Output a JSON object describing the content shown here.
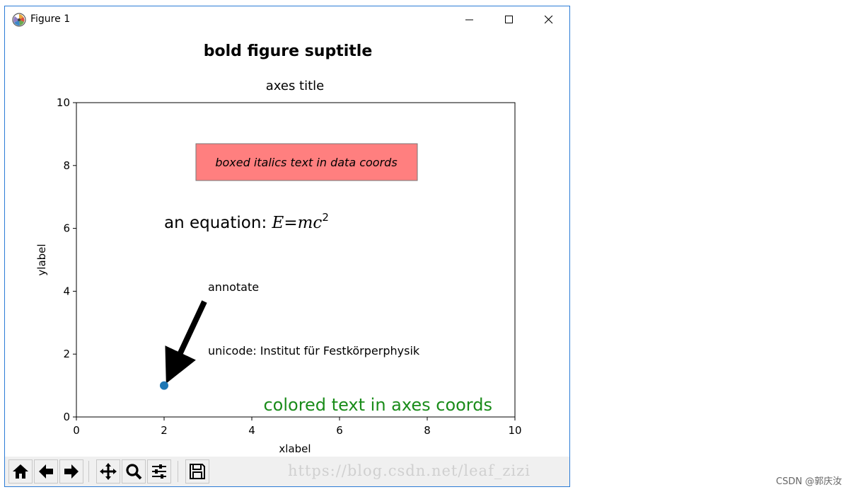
{
  "window": {
    "title": "Figure 1"
  },
  "figure": {
    "suptitle": "bold figure suptitle",
    "axes_title": "axes title",
    "xlabel": "xlabel",
    "ylabel": "ylabel",
    "boxed_text": "boxed italics text in data coords",
    "equation_prefix": "an equation: ",
    "equation_E": "E",
    "equation_eq": "=",
    "equation_mc": "mc",
    "equation_exp": "2",
    "annotate_text": "annotate",
    "unicode_text": "unicode: Institut für Festkörperphysik",
    "colored_text": "colored text in axes coords"
  },
  "chart_data": {
    "type": "scatter",
    "title": "axes title",
    "xlabel": "xlabel",
    "ylabel": "ylabel",
    "xlim": [
      0,
      10
    ],
    "ylim": [
      0,
      10
    ],
    "xticks": [
      "0",
      "2",
      "4",
      "6",
      "8",
      "10"
    ],
    "yticks": [
      "0",
      "2",
      "4",
      "6",
      "8",
      "10"
    ],
    "points": [
      {
        "x": 2,
        "y": 1
      }
    ],
    "colors": {
      "point": "#1f77b4",
      "box_fill": "#ff7f7f",
      "colored_text": "#1a8c1a"
    },
    "annotations": [
      {
        "text": "boxed italics text in data coords",
        "x": 3,
        "y": 8,
        "style": "italic-boxed"
      },
      {
        "text": "an equation: E=mc²",
        "x": 2,
        "y": 6
      },
      {
        "text": "annotate",
        "x": 3,
        "y": 4,
        "arrow_to": {
          "x": 2,
          "y": 1
        }
      },
      {
        "text": "unicode: Institut für Festkörperphysik",
        "x": 3,
        "y": 2
      },
      {
        "text": "colored text in axes coords",
        "style": "axes-coords-green"
      }
    ]
  },
  "toolbar": {
    "buttons": [
      "home-icon",
      "back-icon",
      "forward-icon",
      "pan-icon",
      "zoom-icon",
      "configure-subplots-icon",
      "save-icon"
    ],
    "watermark": "https://blog.csdn.net/leaf_zizi"
  },
  "page_watermark": "CSDN @郭庆汝"
}
